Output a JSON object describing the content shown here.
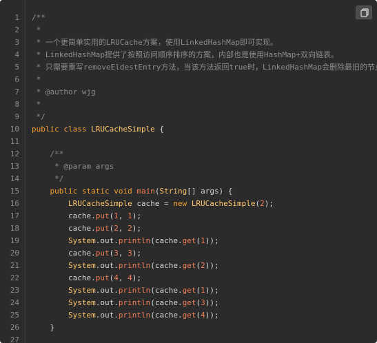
{
  "code": {
    "line_numbers": [
      "1",
      "2",
      "3",
      "4",
      "5",
      "6",
      "7",
      "8",
      "9",
      "10",
      "11",
      "12",
      "13",
      "14",
      "15",
      "16",
      "17",
      "18",
      "19",
      "20",
      "21",
      "22",
      "23",
      "24",
      "25",
      "26",
      "27"
    ],
    "lines": [
      [
        {
          "t": "/**",
          "c": "comment"
        }
      ],
      [
        {
          "t": " *",
          "c": "comment"
        }
      ],
      [
        {
          "t": " * 一个更简单实用的LRUCache方案，使用LinkedHashMap即可实现。",
          "c": "comment"
        }
      ],
      [
        {
          "t": " * LinkedHashMap提供了按照访问顺序排序的方案，内部也是使用HashMap+双向链表。",
          "c": "comment"
        }
      ],
      [
        {
          "t": " * 只需要重写removeEldestEntry方法，当该方法返回true时，LinkedHashMap会删除最旧的节点。",
          "c": "comment"
        }
      ],
      [
        {
          "t": " *",
          "c": "comment"
        }
      ],
      [
        {
          "t": " * @author wjg",
          "c": "comment"
        }
      ],
      [
        {
          "t": " *",
          "c": "comment"
        }
      ],
      [
        {
          "t": " */",
          "c": "comment"
        }
      ],
      [
        {
          "t": "public class ",
          "c": "kw"
        },
        {
          "t": "LRUCacheSimple",
          "c": "type"
        },
        {
          "t": " {",
          "c": "plain"
        }
      ],
      [
        {
          "t": "",
          "c": "plain"
        }
      ],
      [
        {
          "t": "    /**",
          "c": "comment"
        }
      ],
      [
        {
          "t": "     * @param args",
          "c": "comment"
        }
      ],
      [
        {
          "t": "     */",
          "c": "comment"
        }
      ],
      [
        {
          "t": "    public static void ",
          "c": "kw"
        },
        {
          "t": "main",
          "c": "fn"
        },
        {
          "t": "(",
          "c": "plain"
        },
        {
          "t": "String",
          "c": "type"
        },
        {
          "t": "[] args) {",
          "c": "plain"
        }
      ],
      [
        {
          "t": "        ",
          "c": "plain"
        },
        {
          "t": "LRUCacheSimple",
          "c": "type"
        },
        {
          "t": " cache = ",
          "c": "plain"
        },
        {
          "t": "new ",
          "c": "kw"
        },
        {
          "t": "LRUCacheSimple",
          "c": "type"
        },
        {
          "t": "(",
          "c": "plain"
        },
        {
          "t": "2",
          "c": "num"
        },
        {
          "t": ");",
          "c": "plain"
        }
      ],
      [
        {
          "t": "        cache.",
          "c": "plain"
        },
        {
          "t": "put",
          "c": "fn"
        },
        {
          "t": "(",
          "c": "plain"
        },
        {
          "t": "1",
          "c": "num"
        },
        {
          "t": ", ",
          "c": "plain"
        },
        {
          "t": "1",
          "c": "num"
        },
        {
          "t": ");",
          "c": "plain"
        }
      ],
      [
        {
          "t": "        cache.",
          "c": "plain"
        },
        {
          "t": "put",
          "c": "fn"
        },
        {
          "t": "(",
          "c": "plain"
        },
        {
          "t": "2",
          "c": "num"
        },
        {
          "t": ", ",
          "c": "plain"
        },
        {
          "t": "2",
          "c": "num"
        },
        {
          "t": ");",
          "c": "plain"
        }
      ],
      [
        {
          "t": "        ",
          "c": "plain"
        },
        {
          "t": "System",
          "c": "type"
        },
        {
          "t": ".out.",
          "c": "plain"
        },
        {
          "t": "println",
          "c": "fn"
        },
        {
          "t": "(cache.",
          "c": "plain"
        },
        {
          "t": "get",
          "c": "fn"
        },
        {
          "t": "(",
          "c": "plain"
        },
        {
          "t": "1",
          "c": "num"
        },
        {
          "t": "));",
          "c": "plain"
        }
      ],
      [
        {
          "t": "        cache.",
          "c": "plain"
        },
        {
          "t": "put",
          "c": "fn"
        },
        {
          "t": "(",
          "c": "plain"
        },
        {
          "t": "3",
          "c": "num"
        },
        {
          "t": ", ",
          "c": "plain"
        },
        {
          "t": "3",
          "c": "num"
        },
        {
          "t": ");",
          "c": "plain"
        }
      ],
      [
        {
          "t": "        ",
          "c": "plain"
        },
        {
          "t": "System",
          "c": "type"
        },
        {
          "t": ".out.",
          "c": "plain"
        },
        {
          "t": "println",
          "c": "fn"
        },
        {
          "t": "(cache.",
          "c": "plain"
        },
        {
          "t": "get",
          "c": "fn"
        },
        {
          "t": "(",
          "c": "plain"
        },
        {
          "t": "2",
          "c": "num"
        },
        {
          "t": "));",
          "c": "plain"
        }
      ],
      [
        {
          "t": "        cache.",
          "c": "plain"
        },
        {
          "t": "put",
          "c": "fn"
        },
        {
          "t": "(",
          "c": "plain"
        },
        {
          "t": "4",
          "c": "num"
        },
        {
          "t": ", ",
          "c": "plain"
        },
        {
          "t": "4",
          "c": "num"
        },
        {
          "t": ");",
          "c": "plain"
        }
      ],
      [
        {
          "t": "        ",
          "c": "plain"
        },
        {
          "t": "System",
          "c": "type"
        },
        {
          "t": ".out.",
          "c": "plain"
        },
        {
          "t": "println",
          "c": "fn"
        },
        {
          "t": "(cache.",
          "c": "plain"
        },
        {
          "t": "get",
          "c": "fn"
        },
        {
          "t": "(",
          "c": "plain"
        },
        {
          "t": "1",
          "c": "num"
        },
        {
          "t": "));",
          "c": "plain"
        }
      ],
      [
        {
          "t": "        ",
          "c": "plain"
        },
        {
          "t": "System",
          "c": "type"
        },
        {
          "t": ".out.",
          "c": "plain"
        },
        {
          "t": "println",
          "c": "fn"
        },
        {
          "t": "(cache.",
          "c": "plain"
        },
        {
          "t": "get",
          "c": "fn"
        },
        {
          "t": "(",
          "c": "plain"
        },
        {
          "t": "3",
          "c": "num"
        },
        {
          "t": "));",
          "c": "plain"
        }
      ],
      [
        {
          "t": "        ",
          "c": "plain"
        },
        {
          "t": "System",
          "c": "type"
        },
        {
          "t": ".out.",
          "c": "plain"
        },
        {
          "t": "println",
          "c": "fn"
        },
        {
          "t": "(cache.",
          "c": "plain"
        },
        {
          "t": "get",
          "c": "fn"
        },
        {
          "t": "(",
          "c": "plain"
        },
        {
          "t": "4",
          "c": "num"
        },
        {
          "t": "));",
          "c": "plain"
        }
      ],
      [
        {
          "t": "    }",
          "c": "plain"
        }
      ],
      [
        {
          "t": "",
          "c": "plain"
        }
      ]
    ]
  },
  "copy_button": {
    "icon": "copy-icon"
  },
  "colors": {
    "background": "#2b2b2b",
    "comment": "#8c8c8c",
    "keyword": "#f0a035",
    "type": "#ffc66d",
    "function": "#f07e55",
    "number": "#f07e55",
    "plain": "#d4d4d4",
    "line_number": "#8a8a8a"
  }
}
